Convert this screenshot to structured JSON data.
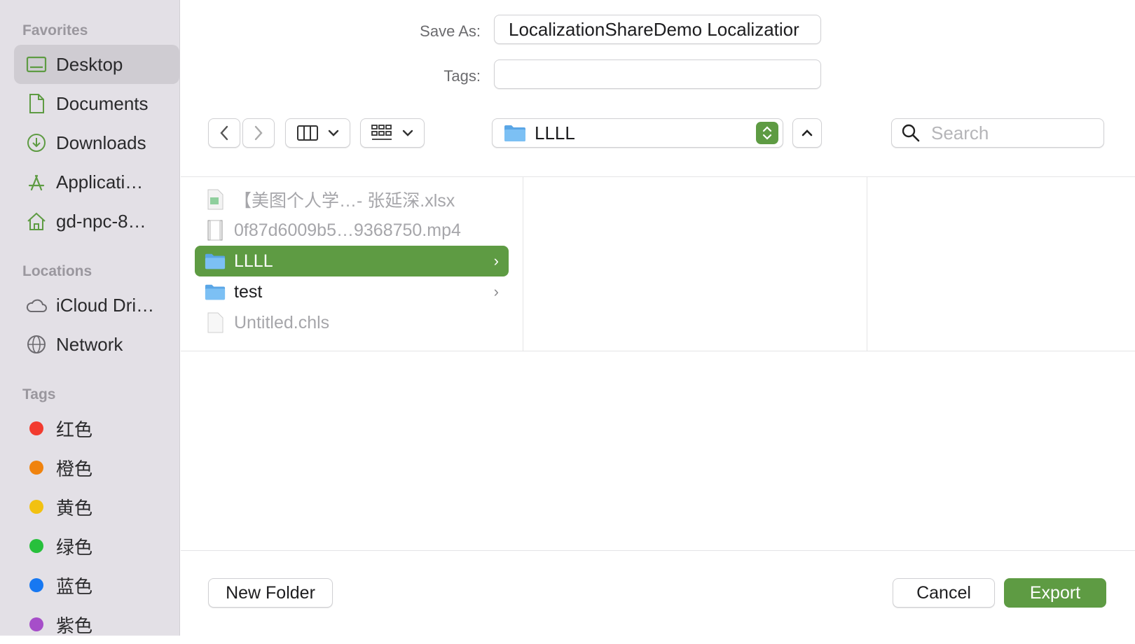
{
  "sidebar": {
    "favorites_header": "Favorites",
    "favorites": [
      {
        "label": "Desktop",
        "icon": "desktop-icon"
      },
      {
        "label": "Documents",
        "icon": "document-icon"
      },
      {
        "label": "Downloads",
        "icon": "download-icon"
      },
      {
        "label": "Applicati…",
        "icon": "applications-icon"
      },
      {
        "label": "gd-npc-8…",
        "icon": "home-icon"
      }
    ],
    "locations_header": "Locations",
    "locations": [
      {
        "label": "iCloud Dri…",
        "icon": "cloud-icon"
      },
      {
        "label": "Network",
        "icon": "globe-icon"
      }
    ],
    "tags_header": "Tags",
    "tags": [
      {
        "label": "红色",
        "color": "#f23b2f"
      },
      {
        "label": "橙色",
        "color": "#f0830e"
      },
      {
        "label": "黄色",
        "color": "#f2c111"
      },
      {
        "label": "绿色",
        "color": "#27c03c"
      },
      {
        "label": "蓝色",
        "color": "#1778f2"
      },
      {
        "label": "紫色",
        "color": "#a64ec9"
      }
    ]
  },
  "form": {
    "save_as_label": "Save As:",
    "save_as_value": "LocalizationShareDemo Localizatior",
    "tags_label": "Tags:",
    "tags_value": ""
  },
  "toolbar": {
    "location": "LLLL",
    "search_placeholder": "Search"
  },
  "files": [
    {
      "name": "【美图个人学…- 张延深.xlsx",
      "icon": "spreadsheet-icon",
      "dim": true
    },
    {
      "name": "0f87d6009b5…9368750.mp4",
      "icon": "video-file-icon",
      "dim": true
    },
    {
      "name": "LLLL",
      "icon": "folder-icon",
      "selected": true,
      "chevron": "›"
    },
    {
      "name": "test",
      "icon": "folder-icon",
      "chevron": "›"
    },
    {
      "name": "Untitled.chls",
      "icon": "file-icon",
      "dim": true
    }
  ],
  "buttons": {
    "new_folder": "New Folder",
    "cancel": "Cancel",
    "export": "Export"
  },
  "colors": {
    "accent": "#5e9b43",
    "sidebar_bg": "#e3e0e6"
  }
}
